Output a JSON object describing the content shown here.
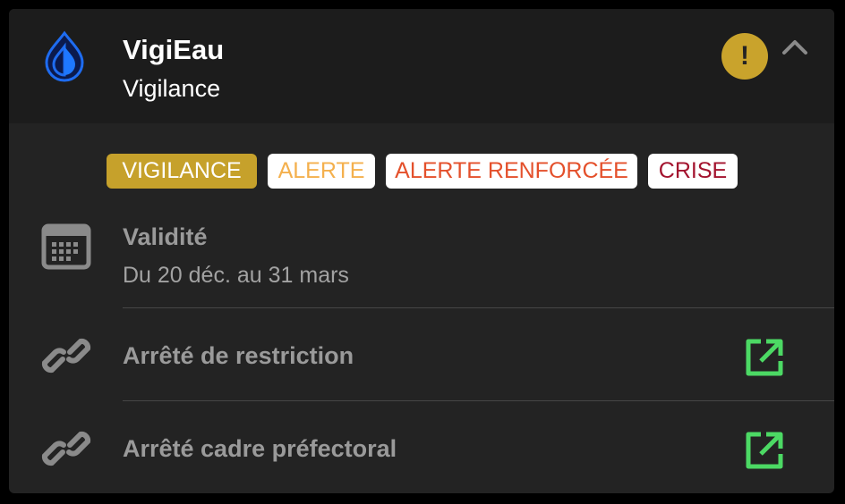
{
  "app": {
    "name": "VigiEau",
    "status": "Vigilance",
    "icon": "water-drop-icon",
    "warning_symbol": "!"
  },
  "levels": [
    {
      "label": "VIGILANCE",
      "color": "#c6a12b",
      "active": true
    },
    {
      "label": "ALERTE",
      "color": "#f4b04d",
      "active": false
    },
    {
      "label": "ALERTE RENFORCÉE",
      "color": "#e4502b",
      "active": false
    },
    {
      "label": "CRISE",
      "color": "#a3132e",
      "active": false
    }
  ],
  "validity": {
    "title": "Validité",
    "dates": "Du 20 déc. au 31 mars",
    "icon": "calendar-icon"
  },
  "links": [
    {
      "label": "Arrêté de restriction",
      "icon": "link-icon",
      "action_icon": "external-link-icon"
    },
    {
      "label": "Arrêté cadre préfectoral",
      "icon": "link-icon",
      "action_icon": "external-link-icon"
    }
  ],
  "colors": {
    "accent_green": "#4cd964",
    "warning": "#c9a32c",
    "drop_blue": "#1877f2"
  }
}
